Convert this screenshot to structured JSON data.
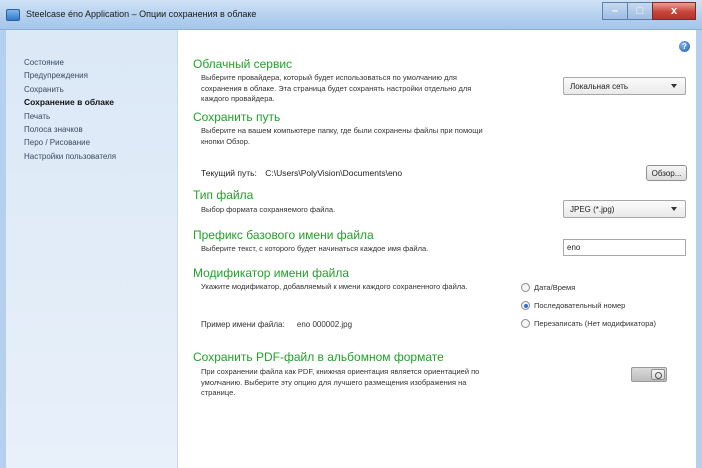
{
  "window": {
    "title": "Steelcase éno Application – Опции сохранения в облаке",
    "minimize": "–",
    "maximize": "□",
    "close": "x"
  },
  "sidebar": {
    "items": [
      {
        "label": "Состояние",
        "active": false
      },
      {
        "label": "Предупреждения",
        "active": false
      },
      {
        "label": "Сохранить",
        "active": false
      },
      {
        "label": "Сохранение в облаке",
        "active": true
      },
      {
        "label": "Печать",
        "active": false
      },
      {
        "label": "Полоса значков",
        "active": false
      },
      {
        "label": "Перо / Рисование",
        "active": false
      },
      {
        "label": "Настройки пользователя",
        "active": false
      }
    ]
  },
  "help": {
    "symbol": "?"
  },
  "cloud_service": {
    "title": "Облачный сервис",
    "description": "Выберите провайдера, который будет использоваться по умолчанию для сохранения в облаке. Эта страница будет сохранять настройки отдельно для каждого провайдера.",
    "provider_value": "Локальная сеть"
  },
  "save_path": {
    "title": "Сохранить путь",
    "description": "Выберите на вашем компьютере папку, где были сохранены файлы при помощи кнопки Обзор.",
    "current_label": "Текущий путь:",
    "current_value": "C:\\Users\\PolyVision\\Documents\\eno",
    "browse_label": "Обзор..."
  },
  "file_type": {
    "title": "Тип файла",
    "description": "Выбор формата сохраняемого файла.",
    "value": "JPEG (*.jpg)"
  },
  "prefix": {
    "title": "Префикс базового имени файла",
    "description": "Выберите текст, с которого будет начинаться каждое имя файла.",
    "value": "eno"
  },
  "modifier": {
    "title": "Модификатор имени файла",
    "description": "Укажите модификатор, добавляемый к имени каждого сохраненного файла.",
    "example_label": "Пример имени файла:",
    "example_value": "eno 000002.jpg",
    "options": [
      {
        "label": "Дата/Время",
        "checked": false
      },
      {
        "label": "Последовательный номер",
        "checked": true
      },
      {
        "label": "Перезаписать (Нет модификатора)",
        "checked": false
      }
    ]
  },
  "pdf": {
    "title": "Сохранить PDF-файл в альбомном формате",
    "description": "При сохранении файла как PDF, книжная ориентация является ориентацией по умолчанию. Выберите эту опцию для лучшего размещения изображения на странице.",
    "enabled": false
  }
}
